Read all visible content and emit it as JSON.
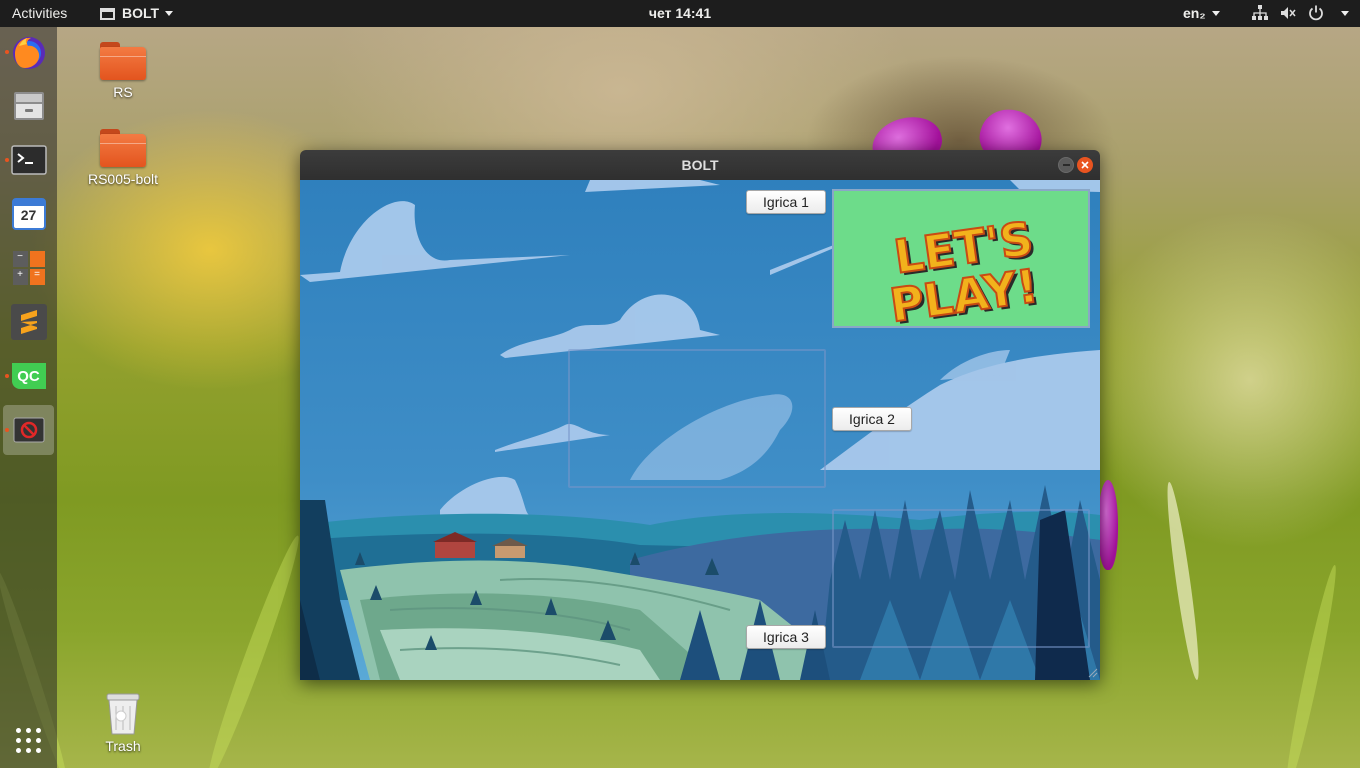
{
  "topbar": {
    "activities": "Activities",
    "app_name": "BOLT",
    "clock": "чет 14:41",
    "language": "en₂",
    "icons": [
      "network-icon",
      "volume-muted-icon",
      "power-icon"
    ]
  },
  "dock": {
    "apps": [
      "firefox-icon",
      "files-icon",
      "terminal-icon",
      "calendar-icon",
      "calculator-icon",
      "sublime-text-icon",
      "qt-creator-icon",
      "bolt-app-icon"
    ],
    "calendar_day": "27",
    "qt_label": "QC"
  },
  "desktop": {
    "icons": [
      {
        "label": "RS"
      },
      {
        "label": "RS005-bolt"
      },
      {
        "label": "Trash"
      }
    ]
  },
  "window": {
    "title": "BOLT",
    "buttons": {
      "game1": "Igrica 1",
      "game2": "Igrica 2",
      "game3": "Igrica 3"
    },
    "banner_text": [
      "LET'S",
      "PLAY!"
    ],
    "colors": {
      "banner_bg": "#6ddc8a",
      "banner_text": "#f2b21c",
      "accent": "#e95420"
    }
  }
}
